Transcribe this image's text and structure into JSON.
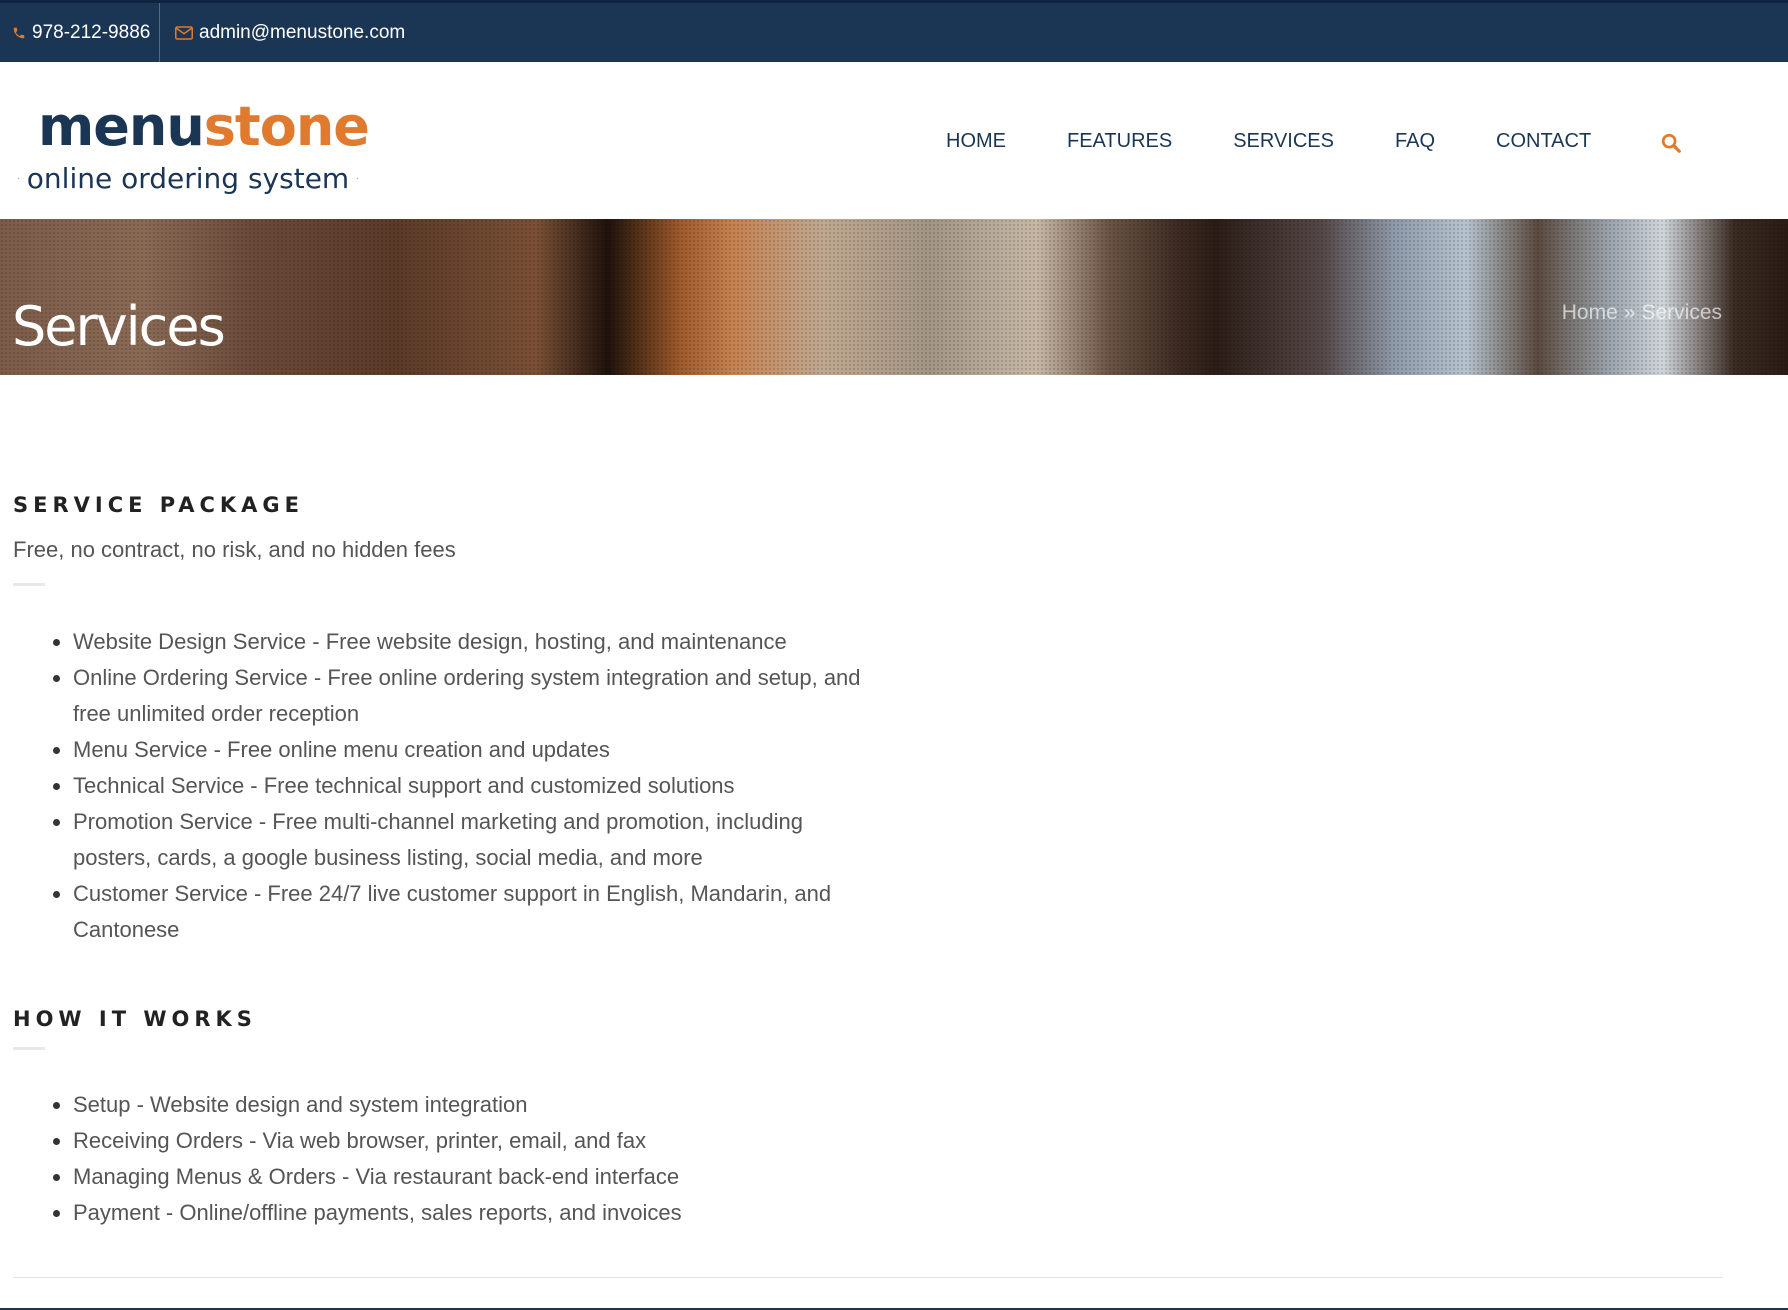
{
  "topbar": {
    "phone": "978-212-9886",
    "email": "admin@menustone.com",
    "phone_icon": "phone-icon",
    "email_icon": "envelope-icon"
  },
  "logo": {
    "main_part1": "menu",
    "main_part2": "stone",
    "tagline": "online ordering system"
  },
  "nav": {
    "items": [
      "HOME",
      "FEATURES",
      "SERVICES",
      "FAQ",
      "CONTACT"
    ],
    "search_icon": "search-icon"
  },
  "hero": {
    "title": "Services",
    "breadcrumb": {
      "home": "Home",
      "separator": "»",
      "current": "Services"
    }
  },
  "service_package": {
    "title": "SERVICE PACKAGE",
    "subtitle": "Free, no contract, no risk, and no hidden fees",
    "items": [
      "Website Design Service - Free website design, hosting, and maintenance",
      "Online Ordering Service - Free online ordering system integration and setup, and free unlimited order reception",
      "Menu Service - Free online menu creation and updates",
      "Technical Service - Free technical support and customized solutions",
      "Promotion Service - Free multi-channel marketing and promotion, including posters, cards, a google business listing, social media, and more",
      "Customer Service - Free 24/7 live customer support in English, Mandarin, and Cantonese"
    ]
  },
  "how_it_works": {
    "title": "HOW IT WORKS",
    "items": [
      "Setup - Website design and system integration",
      "Receiving Orders - Via web browser, printer, email, and fax",
      "Managing Menus & Orders - Via restaurant back-end interface",
      "Payment - Online/offline payments, sales reports, and invoices"
    ]
  },
  "colors": {
    "topbar_bg": "#1b3655",
    "brand_navy": "#1b3655",
    "brand_orange": "#e07a2f"
  }
}
